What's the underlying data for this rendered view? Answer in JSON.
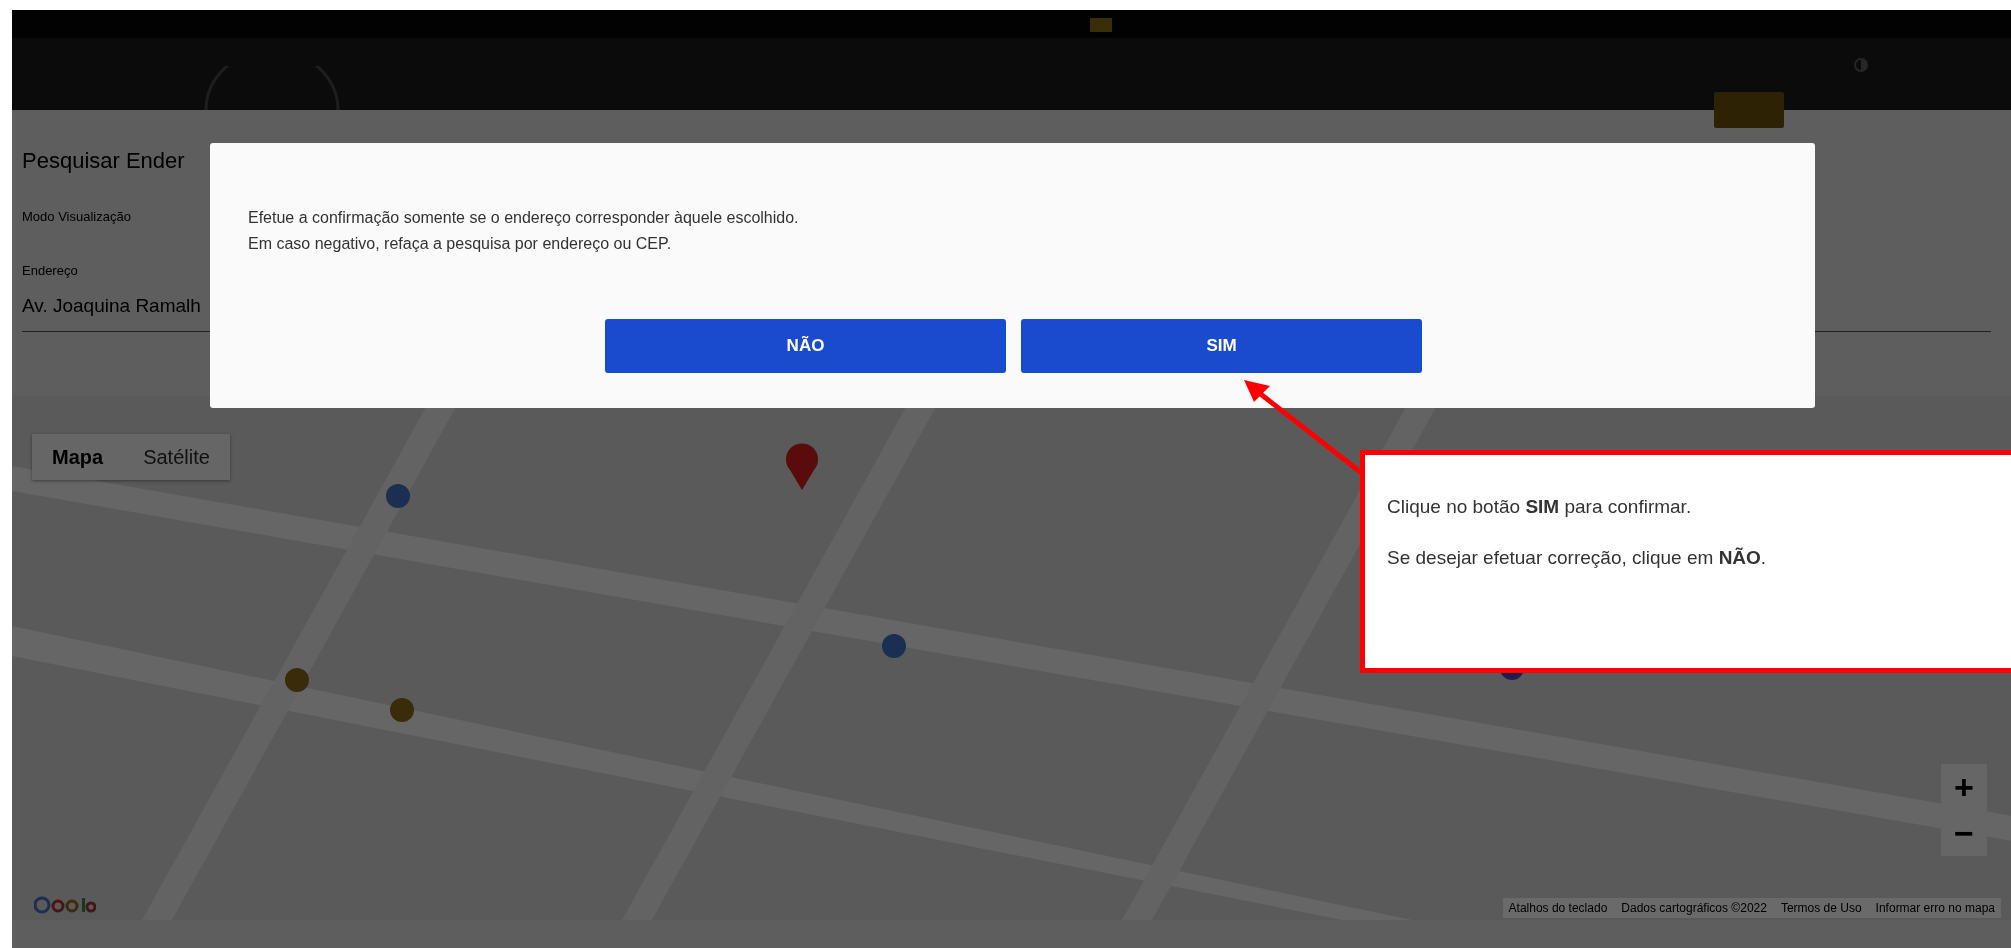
{
  "page": {
    "title": "Pesquisar Ender",
    "view_mode_label": "Modo Visualização",
    "address_label": "Endereço",
    "address_value": "Av. Joaquina Ramalh"
  },
  "map": {
    "kind": "picture",
    "map_types": [
      {
        "label": "Mapa",
        "selected": true
      },
      {
        "label": "Satélite",
        "selected": false
      }
    ],
    "zoom_controls": [
      "+",
      "−"
    ],
    "attribution": [
      "Atalhos do teclado",
      "Dados cartográficos ©2022",
      "Termos de Uso",
      "Informar erro no mapa"
    ]
  },
  "dialog": {
    "message_lines": [
      "Efetue a confirmação somente se o endereço corresponder àquele escolhido.",
      "Em caso negativo, refaça a pesquisa por endereço ou CEP."
    ],
    "buttons": [
      "NÃO",
      "SIM"
    ]
  },
  "callout": {
    "lines": [
      "Clique no botão **SIM** para confirmar.",
      "Se desejar efetuar correção, clique em **NÃO**."
    ]
  }
}
